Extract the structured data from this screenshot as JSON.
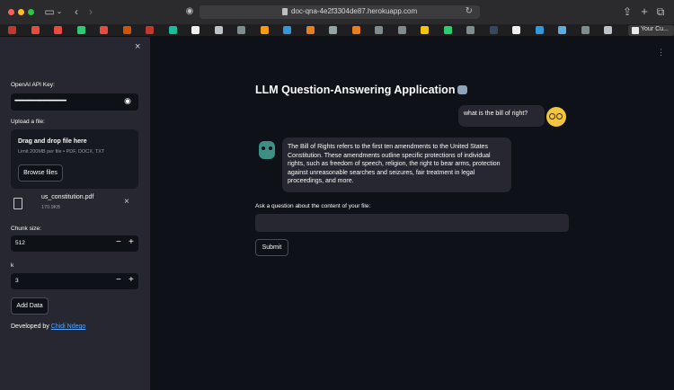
{
  "browser": {
    "url": "doc-qna-4e2f3304de87.herokuapp.com",
    "active_tab_label": "Your Cu...",
    "favorite_colors": [
      "#c0392b",
      "#e74c3c",
      "#e74c3c",
      "#2ecc71",
      "#e74c3c",
      "#d35400",
      "#c0392b",
      "#1abc9c",
      "#ecf0f1",
      "#bdc3c7",
      "#7f8c8d",
      "#f39c12",
      "#3498db",
      "#e67e22",
      "#95a5a6",
      "#e67e22",
      "#7f8c8d",
      "#7f8c8d",
      "#f1c40f",
      "#2ecc71",
      "#7f8c8d",
      "#34495e",
      "#ecf0f1",
      "#3498db",
      "#5dade2",
      "#7f8c8d",
      "#bdc3c7"
    ]
  },
  "sidebar": {
    "close_icon": "×",
    "api_key_label": "OpenAI API Key:",
    "api_key_value": "••••••••••••••••••••••••••••••••••••••••••••••••••••",
    "upload_label": "Upload a file:",
    "drop_title": "Drag and drop file here",
    "drop_subtitle": "Limit 200MB per file • PDF, DOCX, TXT",
    "browse_button": "Browse files",
    "file_name": "us_constitution.pdf",
    "file_size": "170.9KB",
    "chunk_label": "Chunk size:",
    "chunk_value": "512",
    "k_label": "k",
    "k_value": "3",
    "add_data_button": "Add Data",
    "developed_prefix": "Developed by ",
    "developer_name": "Chidi Ndego"
  },
  "main": {
    "title": "LLM Question-Answering Application",
    "user_message": "what is the bill of right?",
    "bot_message": "The Bill of Rights refers to the first ten amendments to the United States Constitution. These amendments outline specific protections of individual rights, such as freedom of speech, religion, the right to bear arms, protection against unreasonable searches and seizures, fair treatment in legal proceedings, and more.",
    "question_label": "Ask a question about the content of your file:",
    "question_value": "",
    "submit_button": "Submit"
  }
}
